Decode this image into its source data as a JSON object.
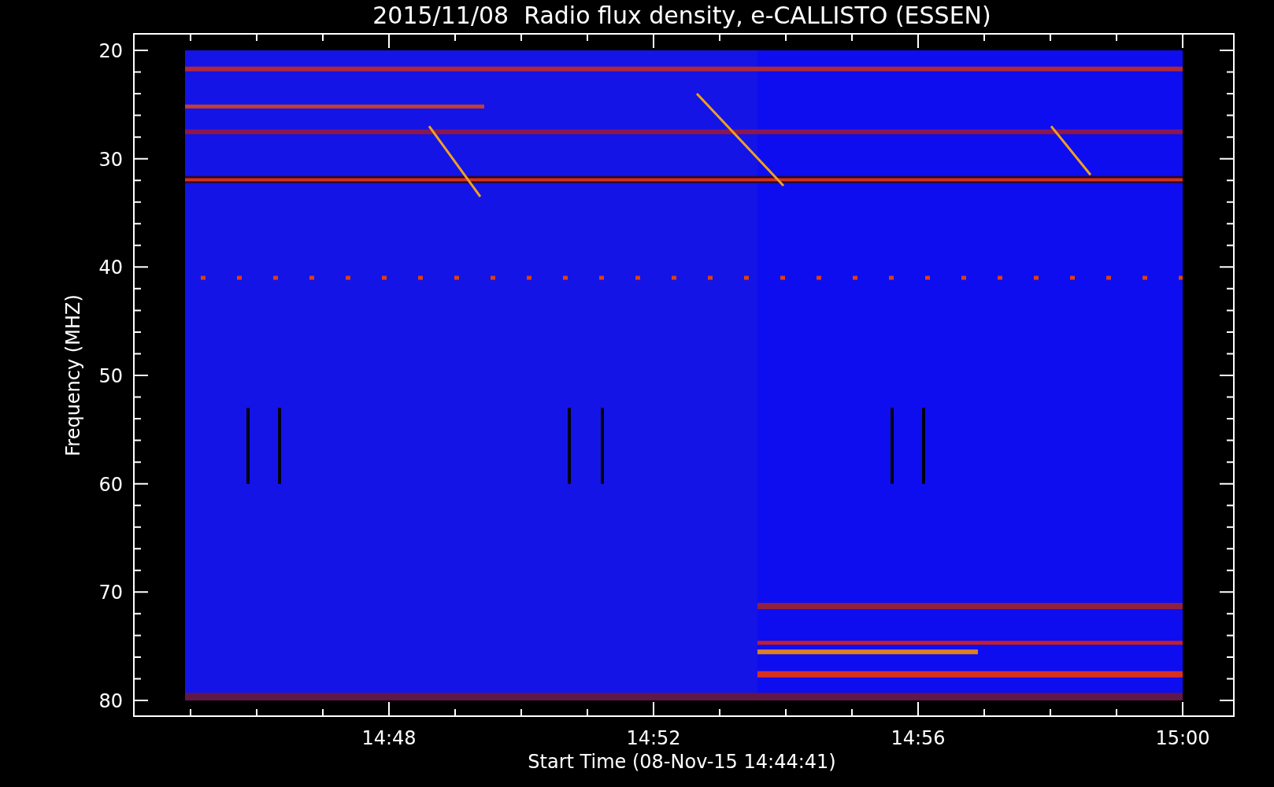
{
  "title": "2015/11/08  Radio flux density, e-CALLISTO (ESSEN)",
  "y_axis": {
    "label": "Frequency (MHZ)",
    "ticks": [
      "20",
      "30",
      "40",
      "50",
      "60",
      "70",
      "80"
    ]
  },
  "x_axis": {
    "label": "Start Time (08-Nov-15 14:44:41)",
    "ticks": [
      "14:48",
      "14:52",
      "14:56",
      "15:00"
    ]
  }
}
